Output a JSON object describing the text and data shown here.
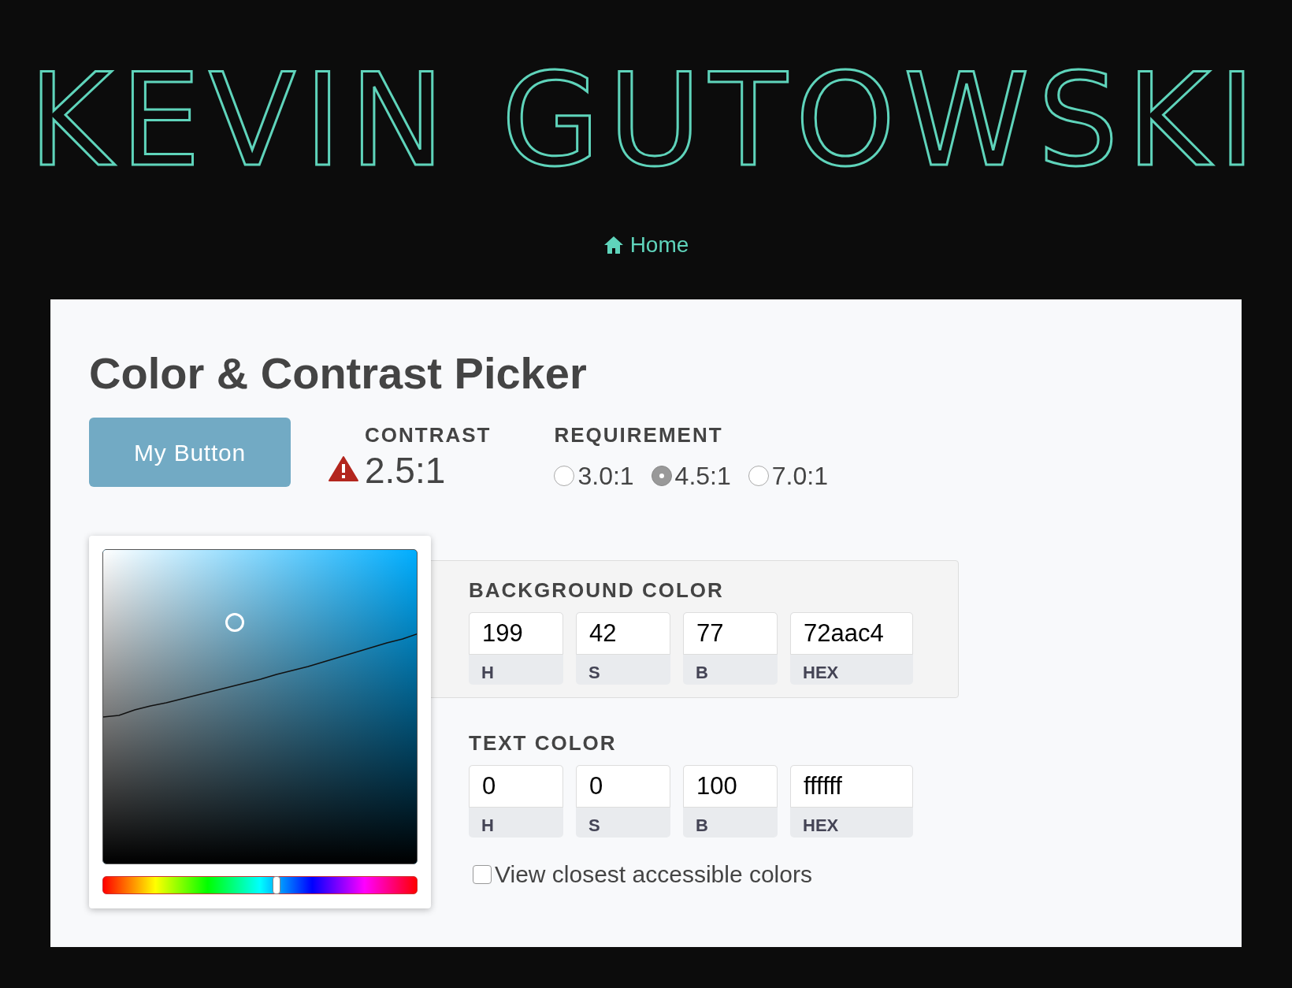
{
  "header": {
    "logo": "KEVIN GUTOWSKI",
    "nav": [
      {
        "label": "Home"
      }
    ]
  },
  "title": "Color & Contrast Picker",
  "sample_button": {
    "label": "My Button"
  },
  "contrast": {
    "label": "CONTRAST",
    "value": "2.5:1",
    "failing": true
  },
  "requirement": {
    "label": "REQUIREMENT",
    "options": [
      {
        "label": "3.0:1",
        "selected": false
      },
      {
        "label": "4.5:1",
        "selected": true
      },
      {
        "label": "7.0:1",
        "selected": false
      }
    ]
  },
  "picker": {
    "hue": {
      "level": 0.553
    }
  },
  "sections": [
    {
      "title": "BACKGROUND COLOR",
      "panel": true,
      "fields": [
        {
          "value": "199",
          "label": "H"
        },
        {
          "value": "42",
          "label": "S"
        },
        {
          "value": "77",
          "label": "B"
        },
        {
          "value": "72aac4",
          "label": "HEX"
        }
      ]
    },
    {
      "title": "TEXT COLOR",
      "panel": false,
      "fields": [
        {
          "value": "0",
          "label": "H"
        },
        {
          "value": "0",
          "label": "S"
        },
        {
          "value": "100",
          "label": "B"
        },
        {
          "value": "ffffff",
          "label": "HEX"
        }
      ]
    }
  ],
  "closest_colors": {
    "label": "View closest accessible colors",
    "checked": false
  }
}
